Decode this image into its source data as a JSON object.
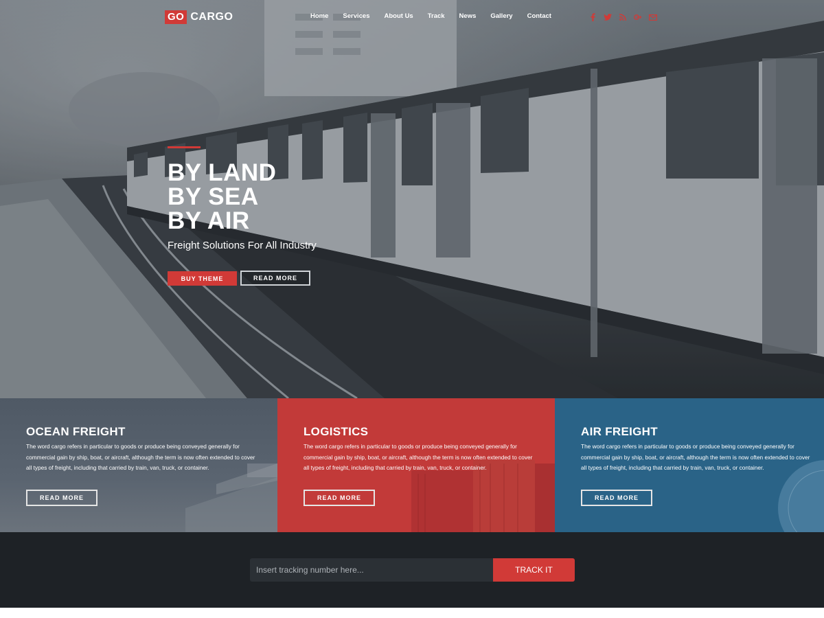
{
  "brand": {
    "logo_go": "GO",
    "logo_cargo": "CARGO",
    "accent_color": "#d13a37"
  },
  "nav": {
    "items": [
      {
        "label": "Home"
      },
      {
        "label": "Services"
      },
      {
        "label": "About Us"
      },
      {
        "label": "Track"
      },
      {
        "label": "News"
      },
      {
        "label": "Gallery"
      },
      {
        "label": "Contact"
      }
    ]
  },
  "social": {
    "icons": [
      "facebook-icon",
      "twitter-icon",
      "rss-icon",
      "google-plus-icon",
      "mail-icon"
    ],
    "glyphs": [
      "f",
      "✉",
      "≡",
      "g+",
      "✉"
    ]
  },
  "hero": {
    "title_lines": [
      "BY LAND",
      "BY SEA",
      "BY AIR"
    ],
    "subtitle": "Freight Solutions For All Industry",
    "buy_label": "BUY THEME",
    "read_more_label": "READ MORE"
  },
  "features": [
    {
      "title": "OCEAN FREIGHT",
      "text": "The word cargo refers in particular to goods or produce being conveyed generally for commercial gain by ship, boat, or aircraft, although the term is now often extended to cover all types of freight, including that carried by train, van, truck, or container.",
      "button": "READ MORE",
      "color": "#4f5965"
    },
    {
      "title": "LOGISTICS",
      "text": "The word cargo refers in particular to goods or produce being conveyed generally for commercial gain by ship, boat, or aircraft, although the term is now often extended to cover all types of freight, including that carried by train, van, truck, or container.",
      "button": "READ MORE",
      "color": "#c23a39"
    },
    {
      "title": "AIR FREIGHT",
      "text": "The word cargo refers in particular to goods or produce being conveyed generally for commercial gain by ship, boat, or aircraft, although the term is now often extended to cover all types of freight, including that carried by train, van, truck, or container.",
      "button": "READ MORE",
      "color": "#2a6387"
    }
  ],
  "track": {
    "placeholder": "Insert tracking number here...",
    "button": "TRACK IT"
  }
}
